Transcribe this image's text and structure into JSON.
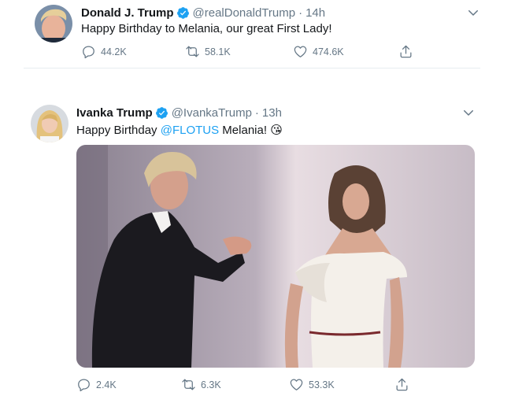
{
  "tweets": [
    {
      "display_name": "Donald J. Trump",
      "handle": "@realDonaldTrump",
      "separator": "·",
      "time": "14h",
      "text": "Happy Birthday to Melania, our great First Lady!",
      "replies": "44.2K",
      "retweets": "58.1K",
      "likes": "474.6K"
    },
    {
      "display_name": "Ivanka Trump",
      "handle": "@IvankaTrump",
      "separator": "·",
      "time": "13h",
      "text_before": "Happy Birthday ",
      "mention": "@FLOTUS",
      "text_after": " Melania! ",
      "emoji": "😘",
      "replies": "2.4K",
      "retweets": "6.3K",
      "likes": "53.3K"
    }
  ],
  "colors": {
    "accent": "#1da1f2",
    "muted": "#657786",
    "text": "#14171a",
    "divider": "#e6ecf0"
  },
  "icons": [
    "verified-badge-icon",
    "chevron-down-icon",
    "reply-icon",
    "retweet-icon",
    "like-icon",
    "share-icon"
  ]
}
